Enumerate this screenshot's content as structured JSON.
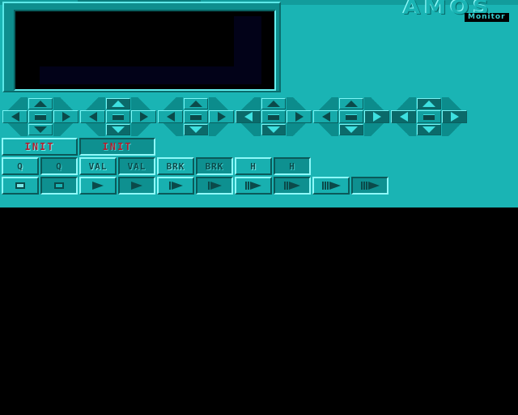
{
  "logo": {
    "title": "AMOS",
    "subtitle": "Monitor"
  },
  "screen": {
    "label": ""
  },
  "joysticks": [
    {
      "id": 1,
      "up": "off",
      "down": "off",
      "left": "off",
      "right": "off",
      "fire": "off"
    },
    {
      "id": 2,
      "up": "on",
      "down": "on",
      "left": "off",
      "right": "off",
      "fire": "off"
    },
    {
      "id": 3,
      "up": "off",
      "down": "on",
      "left": "off",
      "right": "off",
      "fire": "off"
    },
    {
      "id": 4,
      "up": "off",
      "down": "on",
      "left": "on",
      "right": "off",
      "fire": "off"
    },
    {
      "id": 5,
      "up": "off",
      "down": "on",
      "left": "off",
      "right": "on",
      "fire": "off"
    },
    {
      "id": 6,
      "up": "on",
      "down": "on",
      "left": "on",
      "right": "on",
      "fire": "off"
    }
  ],
  "controls": {
    "init_label_1": "INIT",
    "init_label_2": "INIT",
    "q_label_1": "Q",
    "q_label_2": "Q",
    "val_label_1": "VAL",
    "val_label_2": "VAL",
    "brk_label_1": "BRK",
    "brk_label_2": "BRK",
    "h_label_1": "H",
    "h_label_2": "H"
  },
  "transport": [
    {
      "icon": "stop-icon",
      "speed": 0
    },
    {
      "icon": "stop-icon",
      "speed": 0
    },
    {
      "icon": "play-icon",
      "speed": 1
    },
    {
      "icon": "play-icon",
      "speed": 1
    },
    {
      "icon": "play-icon",
      "speed": 2
    },
    {
      "icon": "play-icon",
      "speed": 2
    },
    {
      "icon": "play-icon",
      "speed": 3
    },
    {
      "icon": "play-icon",
      "speed": 3
    },
    {
      "icon": "play-icon",
      "speed": 4
    },
    {
      "icon": "play-icon",
      "speed": 4
    }
  ],
  "colors": {
    "panel": "#1ab4b4",
    "background": "#000000",
    "init_text": "#b02030",
    "icon_dark": "#0b4a4a"
  }
}
